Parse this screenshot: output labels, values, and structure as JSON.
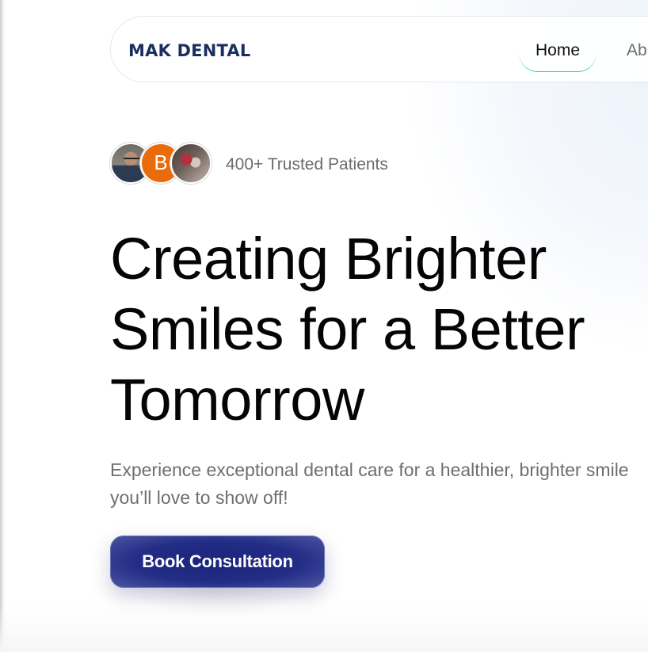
{
  "navbar": {
    "logo": "MAK DENTAL",
    "links": [
      {
        "label": "Home"
      },
      {
        "label": "Ab"
      }
    ]
  },
  "trust": {
    "avatar_2_initial": "B",
    "text": "400+ Trusted Patients"
  },
  "hero": {
    "title": "Creating Brighter Smiles for a Better Tomorrow",
    "subtitle": "Experience exceptional dental care for a healthier, brighter smile you’ll love to show off!",
    "cta_label": "Book Consultation"
  },
  "colors": {
    "brand_navy": "#1b2f5e",
    "cta_blue": "#232d86",
    "accent_teal": "#26c7a3",
    "avatar_orange": "#ea6b0a"
  }
}
